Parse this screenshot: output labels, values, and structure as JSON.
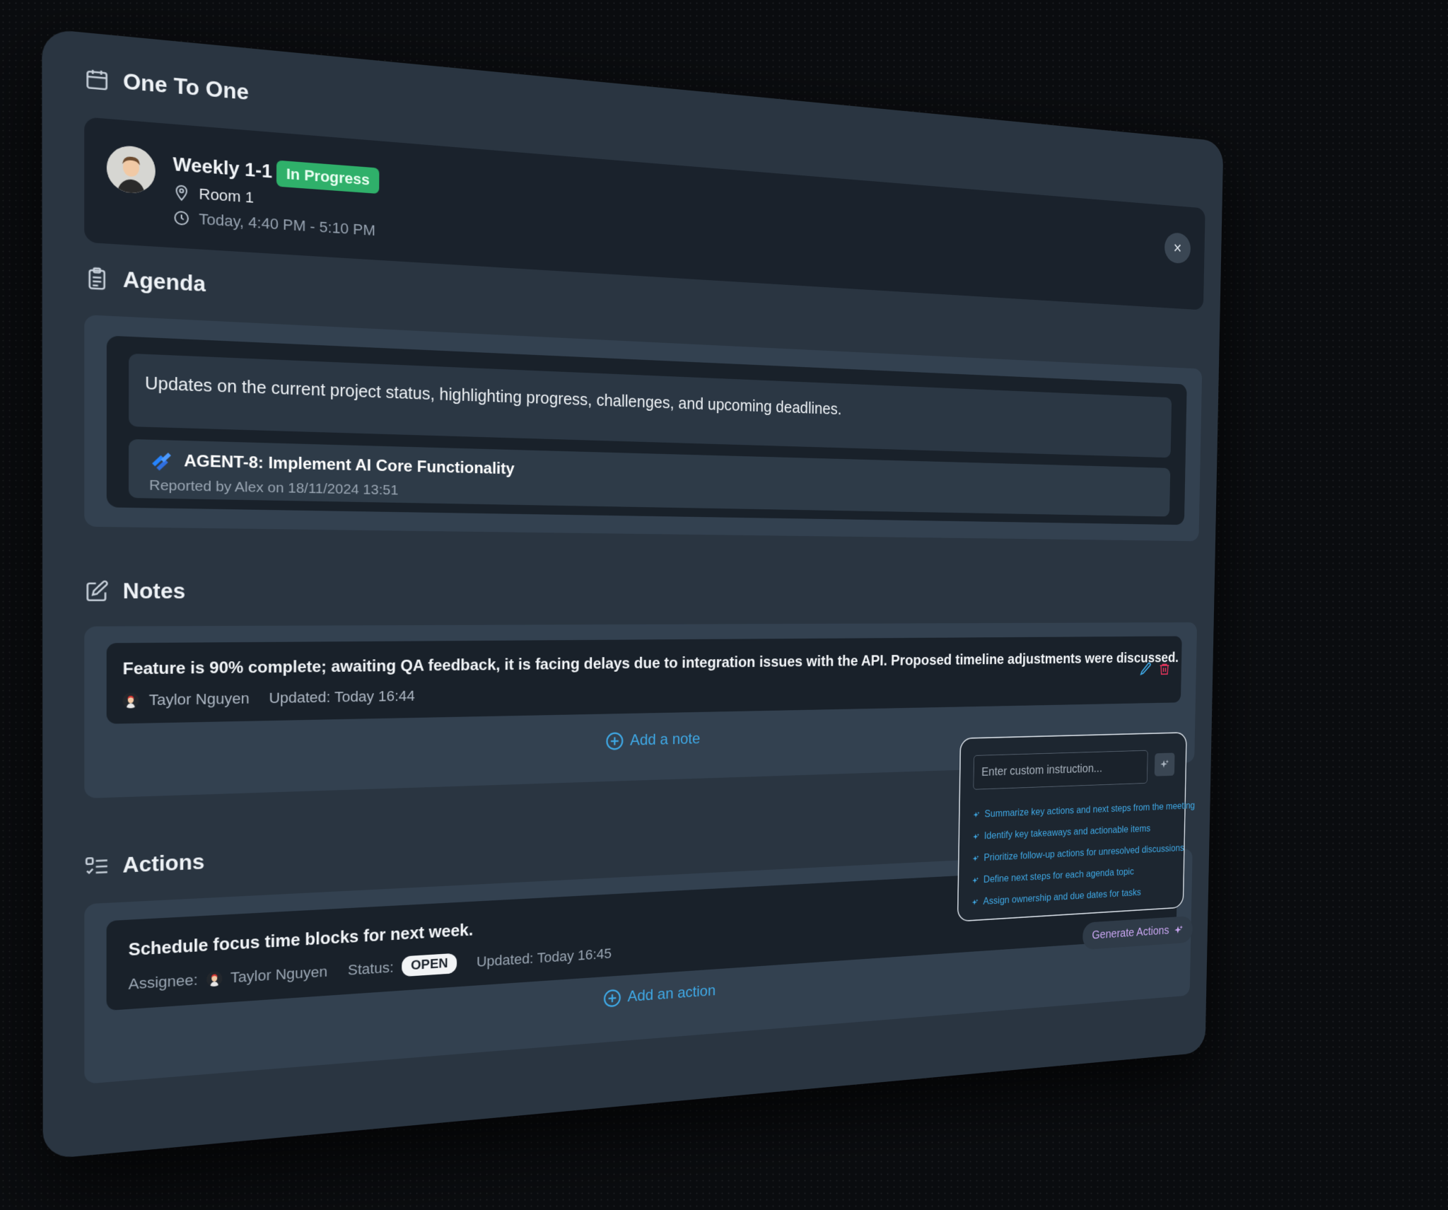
{
  "header": {
    "title": "One To One",
    "close_label": "×"
  },
  "meeting": {
    "title": "Weekly 1-1",
    "status": "In Progress",
    "room": "Room 1",
    "time": "Today, 4:40 PM - 5:10 PM"
  },
  "agenda": {
    "title": "Agenda",
    "description": "Updates on the current project status, highlighting progress, challenges, and upcoming deadlines.",
    "ticket": {
      "title": "AGENT-8: Implement AI Core Functionality",
      "reported": "Reported by Alex on 18/11/2024 13:51"
    }
  },
  "notes": {
    "title": "Notes",
    "items": [
      {
        "text": "Feature is 90% complete; awaiting QA feedback, it is facing delays due to integration issues with the API. Proposed timeline adjustments were discussed.",
        "author": "Taylor Nguyen",
        "updated": "Updated: Today 16:44"
      }
    ],
    "add_label": "Add a note"
  },
  "actions": {
    "title": "Actions",
    "items": [
      {
        "text": "Schedule focus time blocks for next week.",
        "assignee_label": "Assignee:",
        "assignee": "Taylor Nguyen",
        "status_label": "Status:",
        "status": "OPEN",
        "updated": "Updated: Today 16:45"
      }
    ],
    "add_label": "Add an action"
  },
  "ai_panel": {
    "placeholder": "Enter custom instruction...",
    "suggestions": [
      "Summarize key actions and next steps from the meeting",
      "Identify key takeaways and actionable items",
      "Prioritize follow-up actions for unresolved discussions",
      "Define next steps for each agenda topic",
      "Assign ownership and due dates for tasks"
    ],
    "generate_label": "Generate Actions"
  },
  "colors": {
    "accent": "#3fa9e6",
    "status_green": "#2fb06a",
    "generate_purple": "#c9a6f2",
    "delete_red": "#e0345a"
  }
}
